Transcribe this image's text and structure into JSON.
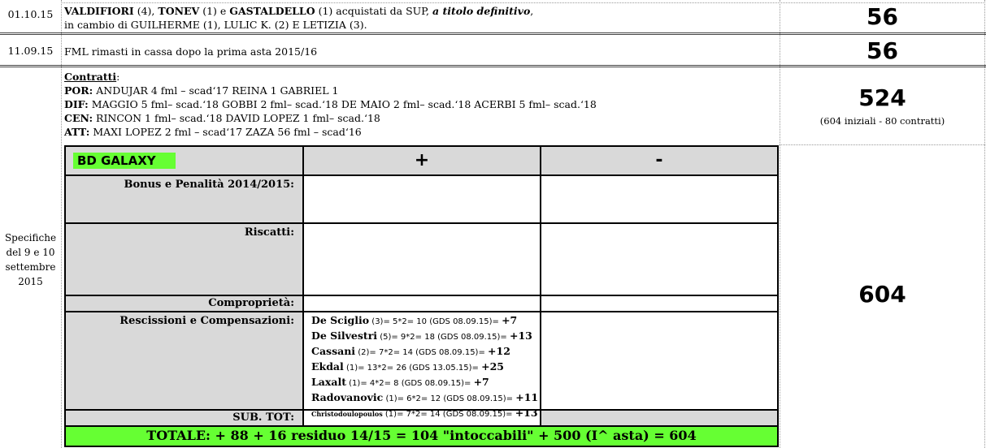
{
  "rows": [
    {
      "date": "01.10.15",
      "line1": {
        "b1": "VALDIFIORI",
        "t1": " (4), ",
        "b2": "TONEV",
        "t2": " (1) e  ",
        "b3": "GASTALDELLO",
        "t3": " (1) acquistati da SUP, ",
        "bi": "a titolo definitivo",
        "t4": ","
      },
      "line2": "in cambio di GUILHERME (1), LULIC K. (2) E LETIZIA (3).",
      "total": "56"
    },
    {
      "date": "11.09.15",
      "text": "FML rimasti in cassa dopo la prima asta 2015/16",
      "total": "56"
    }
  ],
  "contracts": {
    "title": "Contratti",
    "colon": ":",
    "lines": [
      {
        "role": "POR:",
        "text": " ANDUJAR 4 fml – scad‘17  REINA 1  GABRIEL 1"
      },
      {
        "role": "DIF:",
        "text": " MAGGIO 5 fml– scad.‘18  GOBBI 2 fml– scad.‘18  DE MAIO 2 fml– scad.‘18  ACERBI 5 fml– scad.‘18"
      },
      {
        "role": "CEN:",
        "text": " RINCON 1 fml– scad.‘18  DAVID LOPEZ 1 fml– scad.‘18"
      },
      {
        "role": "ATT:",
        "text": " MAXI LOPEZ 2 fml – scad‘17   ZAZA 56 fml – scad‘16"
      }
    ],
    "total": "524",
    "note": "(604 iniziali - 80 contratti)"
  },
  "specifiche": {
    "side_label": [
      "Specifiche",
      "del 9 e 10",
      "settembre",
      "2015"
    ],
    "total": "604",
    "team": "BD GALAXY",
    "plus": "+",
    "minus": "-",
    "labels": {
      "bonus": "Bonus e Penalità 2014/2015:",
      "riscatti": "Riscatti:",
      "compro": "Comproprietà:",
      "resc": "Rescissioni e Compensazioni:",
      "subtot": "SUB. TOT:"
    },
    "rescissioni": [
      {
        "name": "De Sciglio",
        "detail": " (3)= 5*2= 10 (GDS 08.09.15)= ",
        "val": "+7"
      },
      {
        "name": "De Silvestri",
        "detail": " (5)= 9*2= 18 (GDS 08.09.15)= ",
        "val": "+13"
      },
      {
        "name": "Cassani",
        "detail": " (2)= 7*2= 14 (GDS 08.09.15)= ",
        "val": "+12"
      },
      {
        "name": "Ekdal",
        "detail": " (1)= 13*2= 26 (GDS 13.05.15)= ",
        "val": "+25"
      },
      {
        "name": "Laxalt",
        "detail": " (1)= 4*2= 8 (GDS 08.09.15)= ",
        "val": "+7"
      },
      {
        "name": "Radovanovic",
        "detail": " (1)= 6*2= 12 (GDS 08.09.15)= ",
        "val": "+11"
      },
      {
        "name": "Christodoulopoulos",
        "detail": " (1)= 7*2= 14 (GDS 08.09.15)= ",
        "val": "+13"
      }
    ],
    "totale": "TOTALE: + 88 + 16 residuo 14/15 = 104 \"intoccabili\" + 500 (I^ asta) = 604"
  },
  "colors": {
    "green": "#66ff33",
    "grey": "#d9d9d9"
  }
}
